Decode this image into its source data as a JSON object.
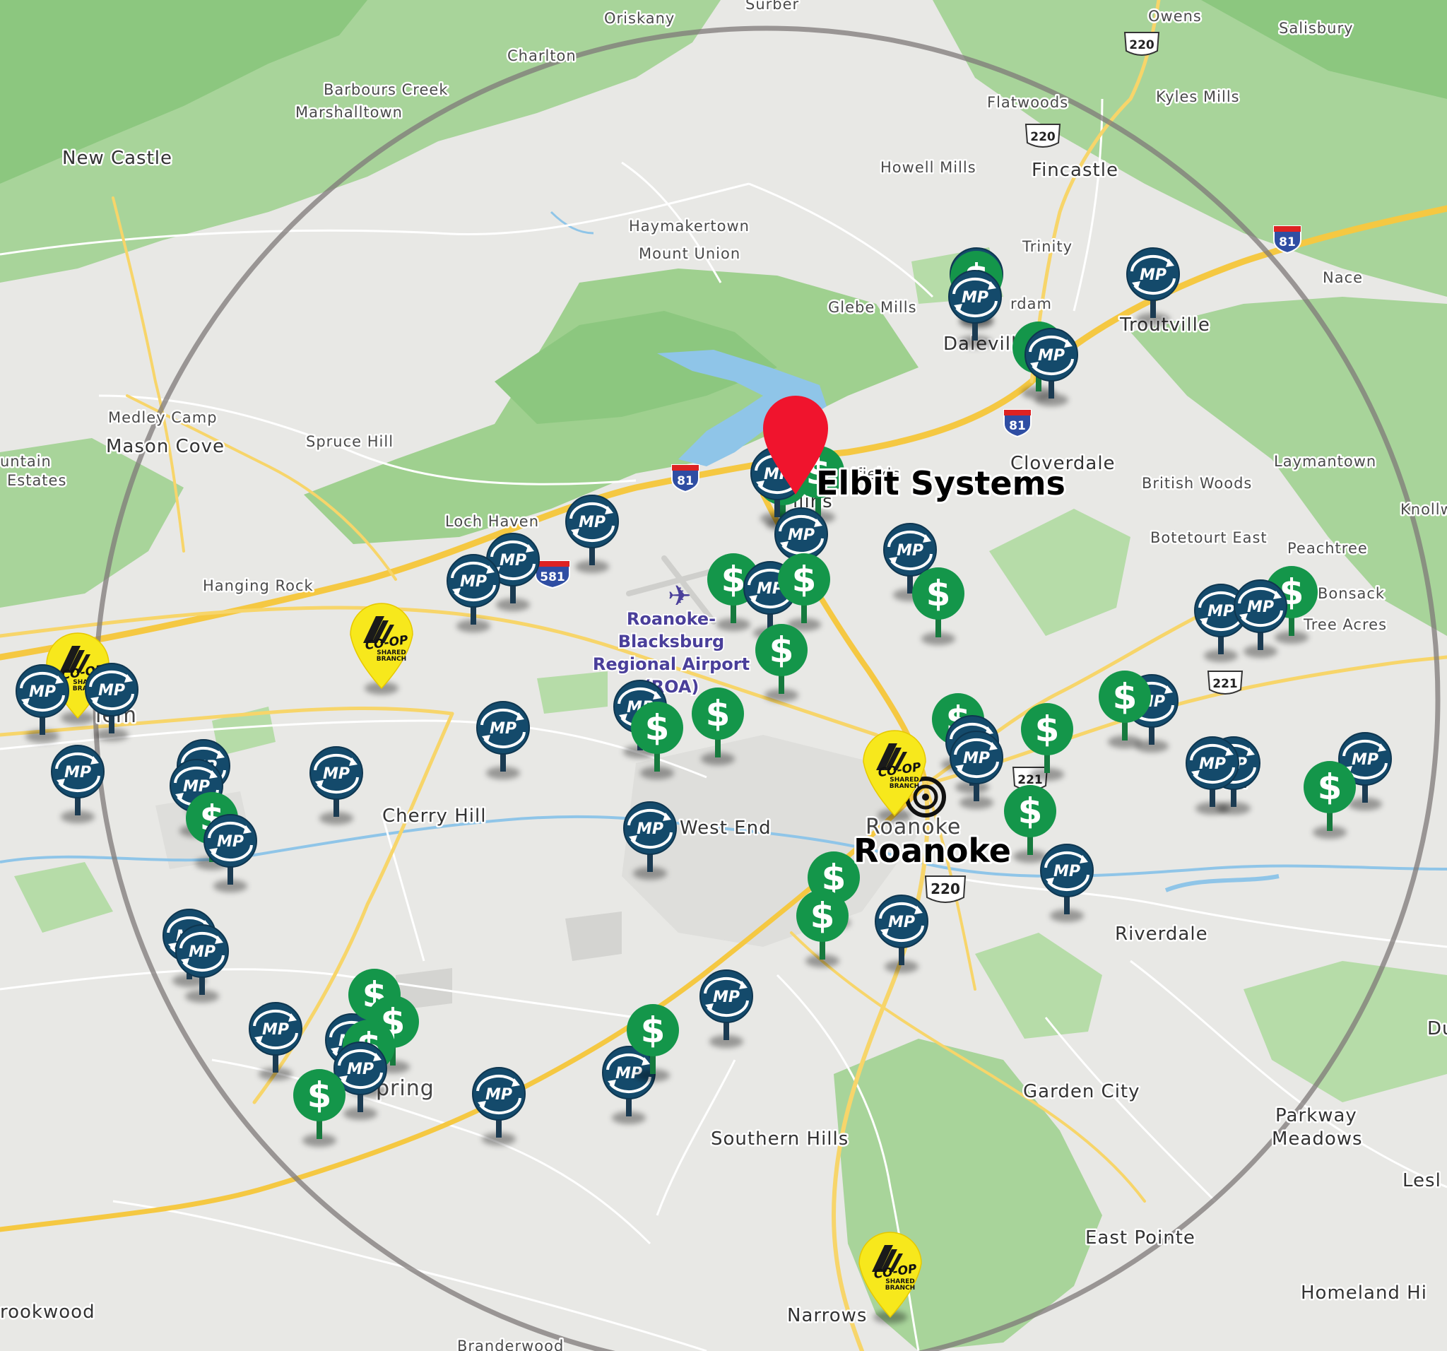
{
  "map": {
    "radius_circle": "on",
    "target": {
      "name": "Elbit Systems",
      "color": "#f0142d"
    },
    "center_city": "Roanoke"
  },
  "places": [
    {
      "id": "new-castle",
      "label": "New Castle"
    },
    {
      "id": "oriskany",
      "label": "Oriskany"
    },
    {
      "id": "surber",
      "label": "Surber"
    },
    {
      "id": "owens",
      "label": "Owens"
    },
    {
      "id": "salisbury",
      "label": "Salisbury"
    },
    {
      "id": "charlton",
      "label": "Charlton"
    },
    {
      "id": "barbours-creek",
      "label": "Barbours Creek"
    },
    {
      "id": "marshalltown",
      "label": "Marshalltown"
    },
    {
      "id": "flatwoods",
      "label": "Flatwoods"
    },
    {
      "id": "kyles-mills",
      "label": "Kyles Mills"
    },
    {
      "id": "howell-mills",
      "label": "Howell Mills"
    },
    {
      "id": "fincastle",
      "label": "Fincastle"
    },
    {
      "id": "haymakertown",
      "label": "Haymakertown"
    },
    {
      "id": "mount-union",
      "label": "Mount Union"
    },
    {
      "id": "trinity",
      "label": "Trinity"
    },
    {
      "id": "nace",
      "label": "Nace"
    },
    {
      "id": "glebe-mills",
      "label": "Glebe Mills"
    },
    {
      "id": "daleville",
      "label": "Daleville"
    },
    {
      "id": "troutville",
      "label": "Troutville"
    },
    {
      "id": "medley-camp",
      "label": "Medley Camp"
    },
    {
      "id": "mason-cove",
      "label": "Mason Cove"
    },
    {
      "id": "spruce-hill",
      "label": "Spruce Hill"
    },
    {
      "id": "untain",
      "label": "untain"
    },
    {
      "id": "estates",
      "label": "Estates"
    },
    {
      "id": "cloverdale",
      "label": "Cloverdale"
    },
    {
      "id": "laymantown",
      "label": "Laymantown"
    },
    {
      "id": "british-woods",
      "label": "British Woods"
    },
    {
      "id": "knollw",
      "label": "Knollw"
    },
    {
      "id": "loch-haven",
      "label": "Loch Haven"
    },
    {
      "id": "botetourt-east",
      "label": "Botetourt East"
    },
    {
      "id": "peachtree",
      "label": "Peachtree"
    },
    {
      "id": "hanging-rock",
      "label": "Hanging Rock"
    },
    {
      "id": "bonsack",
      "label": "Bonsack"
    },
    {
      "id": "tree-acres",
      "label": "Tree Acres"
    },
    {
      "id": "cherry-hill",
      "label": "Cherry Hill"
    },
    {
      "id": "west-end",
      "label": "West End"
    },
    {
      "id": "riverdale",
      "label": "Riverdale"
    },
    {
      "id": "garden-city",
      "label": "Garden City"
    },
    {
      "id": "parkway-meadows-1",
      "label": "Parkway"
    },
    {
      "id": "parkway-meadows-2",
      "label": "Meadows"
    },
    {
      "id": "southern-hills",
      "label": "Southern Hills"
    },
    {
      "id": "lesl",
      "label": "Lesl"
    },
    {
      "id": "east-pointe",
      "label": "East Pointe"
    },
    {
      "id": "homeland-hi",
      "label": "Homeland Hi"
    },
    {
      "id": "rookwood",
      "label": "rookwood"
    },
    {
      "id": "narrows",
      "label": "Narrows"
    },
    {
      "id": "branderwood",
      "label": "Branderwood"
    },
    {
      "id": "du",
      "label": "Du"
    },
    {
      "id": "salem-partial",
      "label": "lem"
    },
    {
      "id": "vinton-partial",
      "label": "on"
    },
    {
      "id": "roanoke-map",
      "label": "Roanoke"
    },
    {
      "id": "spring-partial",
      "label": "pring"
    },
    {
      "id": "hollins-partial",
      "label": "llins"
    },
    {
      "id": "ifields",
      "label": "Ifields"
    },
    {
      "id": "amsterdam",
      "label": "rdam"
    }
  ],
  "airport": {
    "lines": [
      "Roanoke-",
      "Blacksburg",
      "Regional Airport",
      "(ROA)"
    ]
  },
  "shields": [
    {
      "id": "i81-a",
      "text": "81",
      "type": "interstate"
    },
    {
      "id": "i81-b",
      "text": "81",
      "type": "interstate"
    },
    {
      "id": "i81-c",
      "text": "81",
      "type": "interstate"
    },
    {
      "id": "i581",
      "text": "581",
      "type": "interstate"
    },
    {
      "id": "us220-a",
      "text": "220",
      "type": "us"
    },
    {
      "id": "us220-b",
      "text": "220",
      "type": "us"
    },
    {
      "id": "us220-c",
      "text": "220",
      "type": "us"
    },
    {
      "id": "us221-a",
      "text": "221",
      "type": "us"
    },
    {
      "id": "us221-b",
      "text": "221",
      "type": "us"
    }
  ],
  "markers": {
    "mp_label": "MP",
    "atm_label": "$",
    "coop_label": "CO-OP",
    "coop_sub1": "SHARED",
    "coop_sub2": "BRANCH",
    "colors": {
      "mp": "#144a6b",
      "atm": "#14964a",
      "coop": "#f7e81c",
      "target": "#f0142d"
    }
  },
  "labels": {
    "target": "Elbit Systems",
    "city": "Roanoke"
  }
}
